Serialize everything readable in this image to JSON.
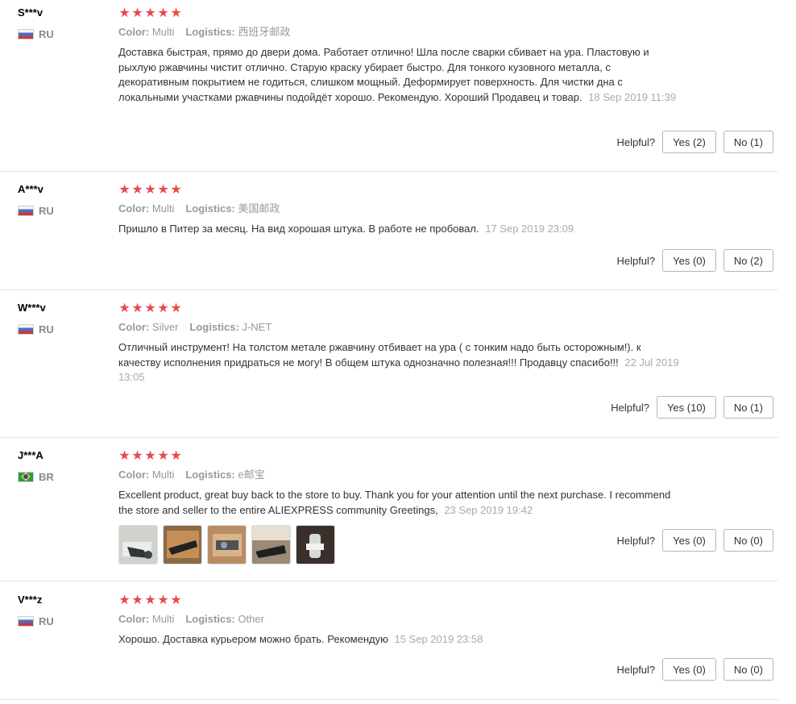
{
  "labels": {
    "color": "Color:",
    "logistics": "Logistics:",
    "helpful": "Helpful?"
  },
  "reviews": [
    {
      "user": "S***v",
      "country": "RU",
      "rating": 5,
      "color": "Multi",
      "logistics": "西班牙邮政",
      "text": "Доставка быстрая, прямо до двери дома. Работает отлично! Шла после сварки сбивает на ура. Пластовую и рыхлую ржавчины чистит отлично. Старую краску убирает быстро. Для тонкого кузовного металла, с декоративным покрытием не годиться, слишком мощный. Деформирует поверхность. Для чистки дна с локальными участками ржавчины подойдёт хорошо. Рекомендую. Хороший Продавец и товар.",
      "date": "18 Sep 2019 11:39",
      "yes": "Yes (2)",
      "no": "No (1)"
    },
    {
      "user": "A***v",
      "country": "RU",
      "rating": 5,
      "color": "Multi",
      "logistics": "美国邮政",
      "text": "Пришло в Питер за месяц. На вид хорошая штука. В работе не пробовал.",
      "date": "17 Sep 2019 23:09",
      "yes": "Yes (0)",
      "no": "No (2)"
    },
    {
      "user": "W***v",
      "country": "RU",
      "rating": 5,
      "color": "Silver",
      "logistics": "J-NET",
      "text": "Отличный инструмент! На толстом метале ржавчину отбивает на ура ( с тонким надо быть осторожным!). к качеству исполнения придраться не могу! В общем штука однозначно полезная!!! Продавцу спасибо!!!",
      "date": "22 Jul 2019 13:05",
      "yes": "Yes (10)",
      "no": "No (1)"
    },
    {
      "user": "J***A",
      "country": "BR",
      "rating": 5,
      "color": "Multi",
      "logistics": "e邮宝",
      "text": "Excellent product, great buy back to the store to buy. Thank you for your attention until the next purchase. I recommend the store and seller to the entire ALIEXPRESS community Greetings,",
      "date": "23 Sep 2019 19:42",
      "yes": "Yes (0)",
      "no": "No (0)",
      "photo_count": 5
    },
    {
      "user": "V***z",
      "country": "RU",
      "rating": 5,
      "color": "Multi",
      "logistics": "Other",
      "text": "Хорошо. Доставка курьером можно брать. Рекомендую",
      "date": "15 Sep 2019 23:58",
      "yes": "Yes (0)",
      "no": "No (0)"
    }
  ],
  "colors": {
    "star": "#e84a4a",
    "meta": "#999999",
    "divider": "#e5e5e5"
  }
}
